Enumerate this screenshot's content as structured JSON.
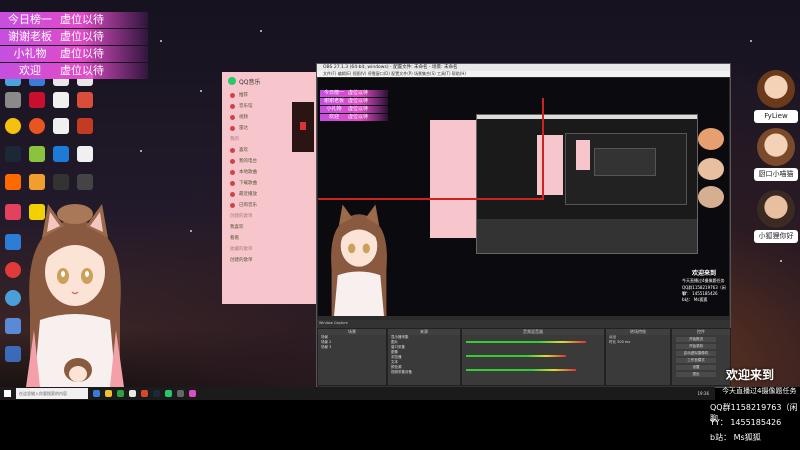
{
  "overlay": {
    "rows": [
      {
        "label": "今日榜一",
        "value": "虚位以待"
      },
      {
        "label": "谢谢老板",
        "value": "虚位以待"
      },
      {
        "label": "小礼物",
        "value": "虚位以待"
      },
      {
        "label": "欢迎",
        "value": "虚位以待"
      }
    ]
  },
  "qq_music": {
    "title": "QQ音乐",
    "nav": [
      "推荐",
      "音乐馆",
      "视频",
      "雷达",
      "我的",
      "喜欢",
      "我的电台",
      "本地歌曲",
      "下载歌曲",
      "最近播放",
      "已购音乐",
      "创建的歌单",
      "我喜欢",
      "看看",
      "收藏的歌单",
      "创建的歌单"
    ]
  },
  "obs": {
    "title": "OBS 27.1.3 (64-bit, windows) - 配置文件: 未命名 - 场景: 未命名",
    "menu": "文件(F)  编辑(E)  视图(V)  停靠窗口(D)  配置文件(P)  场景集合(S)  工具(T)  帮助(H)",
    "dock_scenes": "场景",
    "dock_sources": "来源",
    "dock_mixer": "音频混音器",
    "dock_transitions": "转场特效",
    "dock_controls": "控件",
    "scenes": [
      "场景",
      "场景 2",
      "场景 3"
    ],
    "sources": [
      "显示器采集",
      "图片",
      "窗口采集",
      "图像",
      "浏览器",
      "文本",
      "颜色源",
      "视频采集设备"
    ],
    "controls": [
      "开始推流",
      "开始录制",
      "启动虚拟摄像机",
      "工作室模式",
      "设置",
      "退出"
    ],
    "transition_value": "淡出",
    "duration_label": "时长",
    "duration_value": "300 ms",
    "source_toolbar": "Window Capture"
  },
  "right_panel": {
    "viewers": [
      {
        "name": "FyLiew",
        "color": "#e6a070"
      },
      {
        "name": "厨口小喵猫",
        "color": "#e8c0a0"
      },
      {
        "name": "小狐狸你好",
        "color": "#d4b090"
      }
    ]
  },
  "stream_info": {
    "welcome": "欢迎来到",
    "subtitle": "今天直播过4摄像题任务",
    "qq": "QQ群1158219763（闲聊",
    "yy": "YY： 1455185426",
    "bili": "b站： Ms狐狐"
  },
  "taskbar": {
    "search_placeholder": "在这里输入你要搜索的内容",
    "clock": "19:36"
  },
  "colors": {
    "overlay_pink": "#e04cc8",
    "qq_bg": "#f6c6cc",
    "obs_bg": "#2b2b2b"
  }
}
